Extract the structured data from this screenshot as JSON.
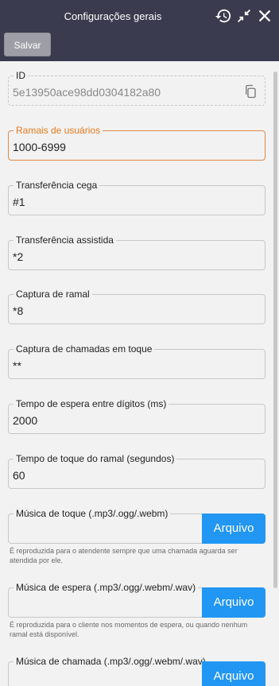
{
  "window": {
    "title": "Configurações gerais",
    "save_label": "Salvar"
  },
  "fields": [
    {
      "label": "ID",
      "value": "5e13950ace98dd0304182a80"
    },
    {
      "label": "Ramais de usuários",
      "value": "1000-6999"
    },
    {
      "label": "Transferência cega",
      "value": "#1"
    },
    {
      "label": "Transferência assistida",
      "value": "*2"
    },
    {
      "label": "Captura de ramal",
      "value": "*8"
    },
    {
      "label": "Captura de chamadas em toque",
      "value": "**"
    },
    {
      "label": "Tempo de espera entre dígitos (ms)",
      "value": "2000"
    },
    {
      "label": "Tempo de toque do ramal (segundos)",
      "value": "60"
    }
  ],
  "files": [
    {
      "label": "Música de toque (.mp3/.ogg/.webm)",
      "button": "Arquivo",
      "hint": "É reproduzida para o atendente sempre que uma chamada aguarda ser atendida por ele."
    },
    {
      "label": "Música de espera (.mp3/.ogg/.webm/.wav)",
      "button": "Arquivo",
      "hint": "É reproduzida para o cliente nos momentos de espera, ou quando nenhum ramal está disponível."
    },
    {
      "label": "Música de chamada (.mp3/.ogg/.webm/.wav)",
      "button": "Arquivo"
    }
  ],
  "icons": {
    "history": "history-icon",
    "collapse": "collapse-icon",
    "close": "close-icon",
    "copy": "copy-icon"
  },
  "colors": {
    "titlebar": "#3b3b4f",
    "accent": "#e57a1c",
    "button": "#2196f3"
  }
}
